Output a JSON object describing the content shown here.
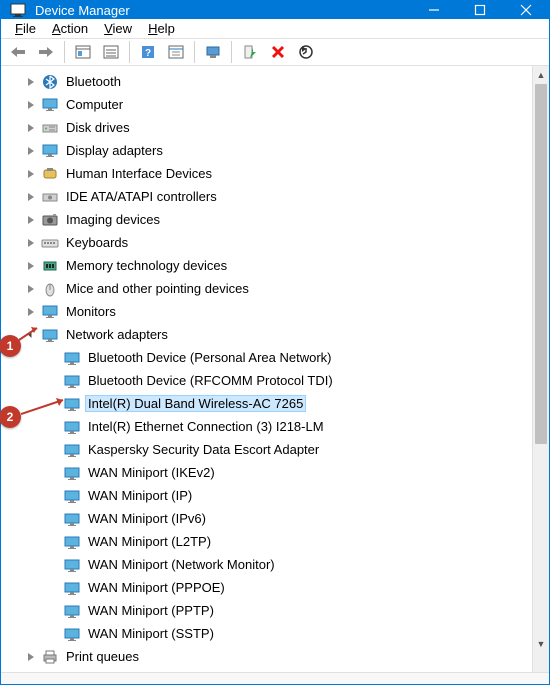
{
  "window": {
    "title": "Device Manager"
  },
  "menu": {
    "file": "File",
    "action": "Action",
    "view": "View",
    "help": "Help"
  },
  "tree": {
    "collapsed": [
      {
        "label": "Bluetooth",
        "icon": "bluetooth"
      },
      {
        "label": "Computer",
        "icon": "computer"
      },
      {
        "label": "Disk drives",
        "icon": "disk"
      },
      {
        "label": "Display adapters",
        "icon": "display"
      },
      {
        "label": "Human Interface Devices",
        "icon": "hid"
      },
      {
        "label": "IDE ATA/ATAPI controllers",
        "icon": "ide"
      },
      {
        "label": "Imaging devices",
        "icon": "imaging"
      },
      {
        "label": "Keyboards",
        "icon": "keyboard"
      },
      {
        "label": "Memory technology devices",
        "icon": "memory"
      },
      {
        "label": "Mice and other pointing devices",
        "icon": "mouse"
      },
      {
        "label": "Monitors",
        "icon": "monitor"
      }
    ],
    "network": {
      "label": "Network adapters",
      "children": [
        {
          "label": "Bluetooth Device (Personal Area Network)"
        },
        {
          "label": "Bluetooth Device (RFCOMM Protocol TDI)"
        },
        {
          "label": "Intel(R) Dual Band Wireless-AC 7265",
          "selected": true
        },
        {
          "label": "Intel(R) Ethernet Connection (3) I218-LM"
        },
        {
          "label": "Kaspersky Security Data Escort Adapter"
        },
        {
          "label": "WAN Miniport (IKEv2)"
        },
        {
          "label": "WAN Miniport (IP)"
        },
        {
          "label": "WAN Miniport (IPv6)"
        },
        {
          "label": "WAN Miniport (L2TP)"
        },
        {
          "label": "WAN Miniport (Network Monitor)"
        },
        {
          "label": "WAN Miniport (PPPOE)"
        },
        {
          "label": "WAN Miniport (PPTP)"
        },
        {
          "label": "WAN Miniport (SSTP)"
        }
      ]
    },
    "after": [
      {
        "label": "Print queues",
        "icon": "printer"
      }
    ]
  },
  "annotations": {
    "one": "1",
    "two": "2"
  }
}
